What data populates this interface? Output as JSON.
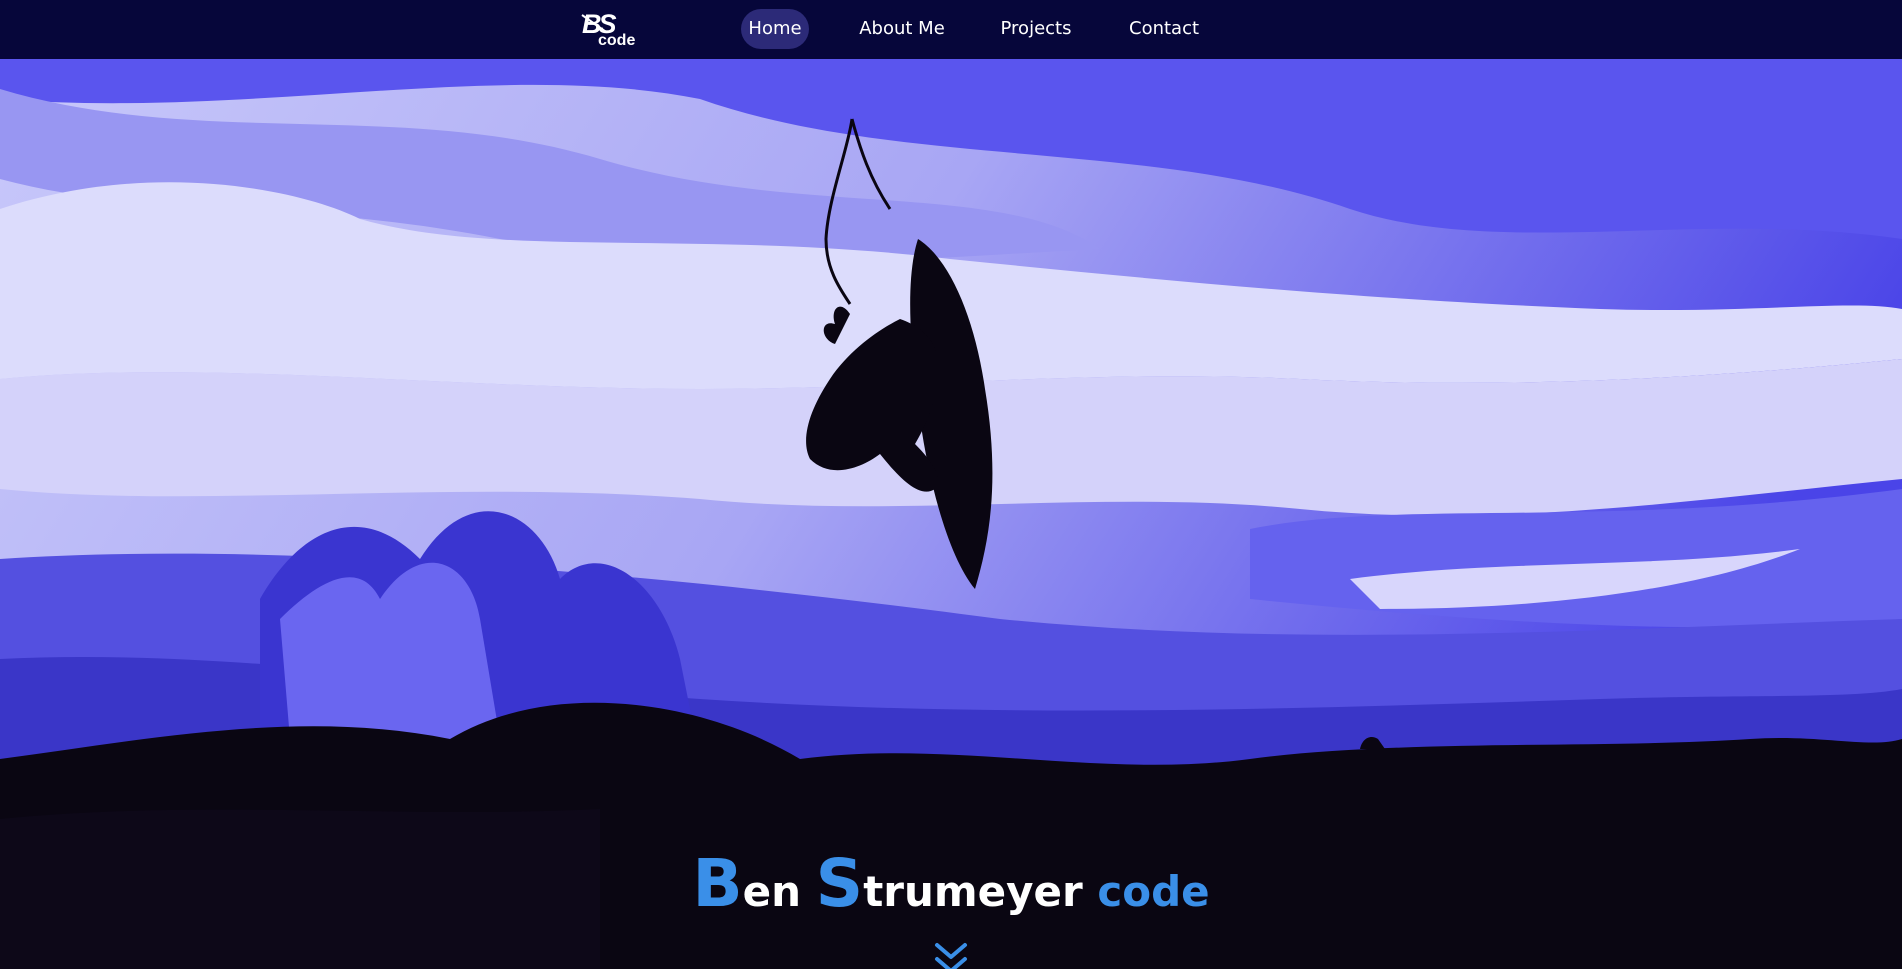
{
  "navbar": {
    "logo": {
      "line1": "BS",
      "line2": "code"
    },
    "items": [
      {
        "label": "Home",
        "active": true
      },
      {
        "label": "About Me",
        "active": false
      },
      {
        "label": "Projects",
        "active": false
      },
      {
        "label": "Contact",
        "active": false
      }
    ]
  },
  "hero": {
    "background": "surfer-silhouette-image",
    "title": {
      "first_initial": "B",
      "first_rest": "en ",
      "last_initial": "S",
      "last_rest": "trumeyer ",
      "suffix": "code"
    },
    "scroll_icon": "double-chevron-down-icon"
  },
  "colors": {
    "nav_bg": "#06063a",
    "nav_active": "#2c2a78",
    "accent": "#3a8fe8",
    "text": "#ffffff"
  }
}
